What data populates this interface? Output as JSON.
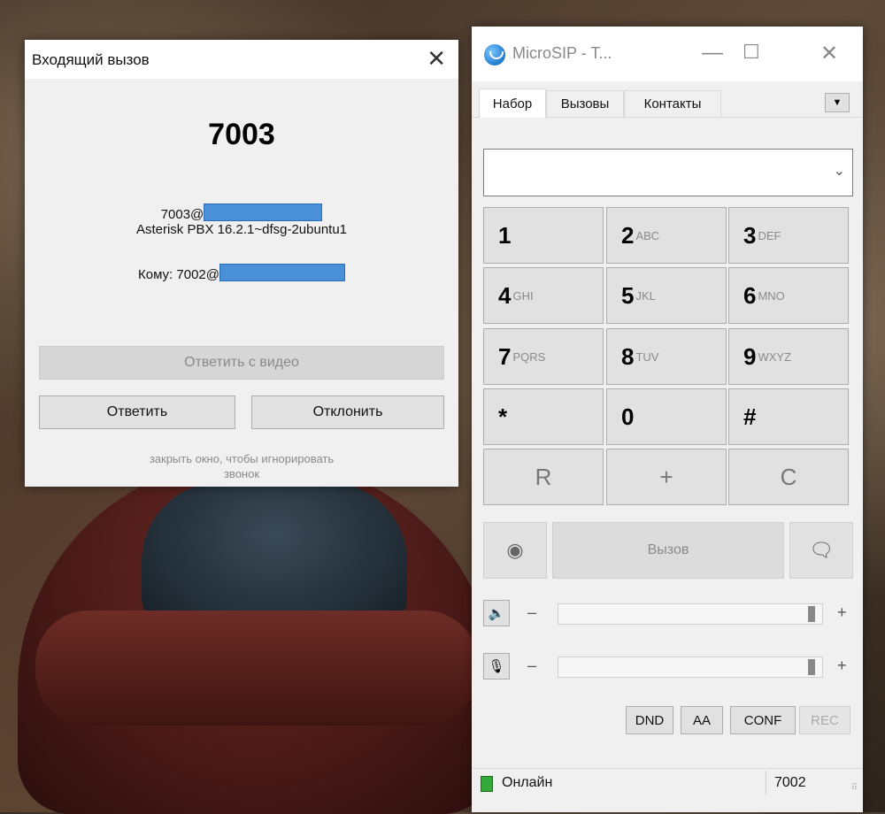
{
  "incoming_dialog": {
    "title": "Входящий вызов",
    "caller_number": "7003",
    "from_prefix": "7003@",
    "user_agent": "Asterisk PBX 16.2.1~dfsg-2ubuntu1",
    "to_prefix": "Кому: 7002@",
    "answer_video_label": "Ответить с видео",
    "answer_label": "Ответить",
    "reject_label": "Отклонить",
    "hint_line1": "закрыть окно, чтобы игнорировать",
    "hint_line2": "звонок"
  },
  "microsip": {
    "window_title": "MicroSIP - T...",
    "tabs": [
      {
        "label": "Набор"
      },
      {
        "label": "Вызовы"
      },
      {
        "label": "Контакты"
      }
    ],
    "number_input": {
      "value": "",
      "placeholder": ""
    },
    "keypad": [
      {
        "digit": "1",
        "letters": ""
      },
      {
        "digit": "2",
        "letters": "ABC"
      },
      {
        "digit": "3",
        "letters": "DEF"
      },
      {
        "digit": "4",
        "letters": "GHI"
      },
      {
        "digit": "5",
        "letters": "JKL"
      },
      {
        "digit": "6",
        "letters": "MNO"
      },
      {
        "digit": "7",
        "letters": "PQRS"
      },
      {
        "digit": "8",
        "letters": "TUV"
      },
      {
        "digit": "9",
        "letters": "WXYZ"
      },
      {
        "digit": "*",
        "letters": ""
      },
      {
        "digit": "0",
        "letters": ""
      },
      {
        "digit": "#",
        "letters": ""
      },
      {
        "digit": "R",
        "letters": ""
      },
      {
        "digit": "+",
        "letters": ""
      },
      {
        "digit": "C",
        "letters": ""
      }
    ],
    "call_label": "Вызов",
    "volume_speaker": {
      "minus": "–",
      "plus": "+",
      "level": 0.98
    },
    "volume_mic": {
      "minus": "–",
      "plus": "+",
      "level": 0.98
    },
    "toggles": {
      "dnd": "DND",
      "aa": "AA",
      "conf": "CONF",
      "rec": "REC"
    },
    "status_text": "Онлайн",
    "account": "7002",
    "status_color": "#35a83a"
  }
}
